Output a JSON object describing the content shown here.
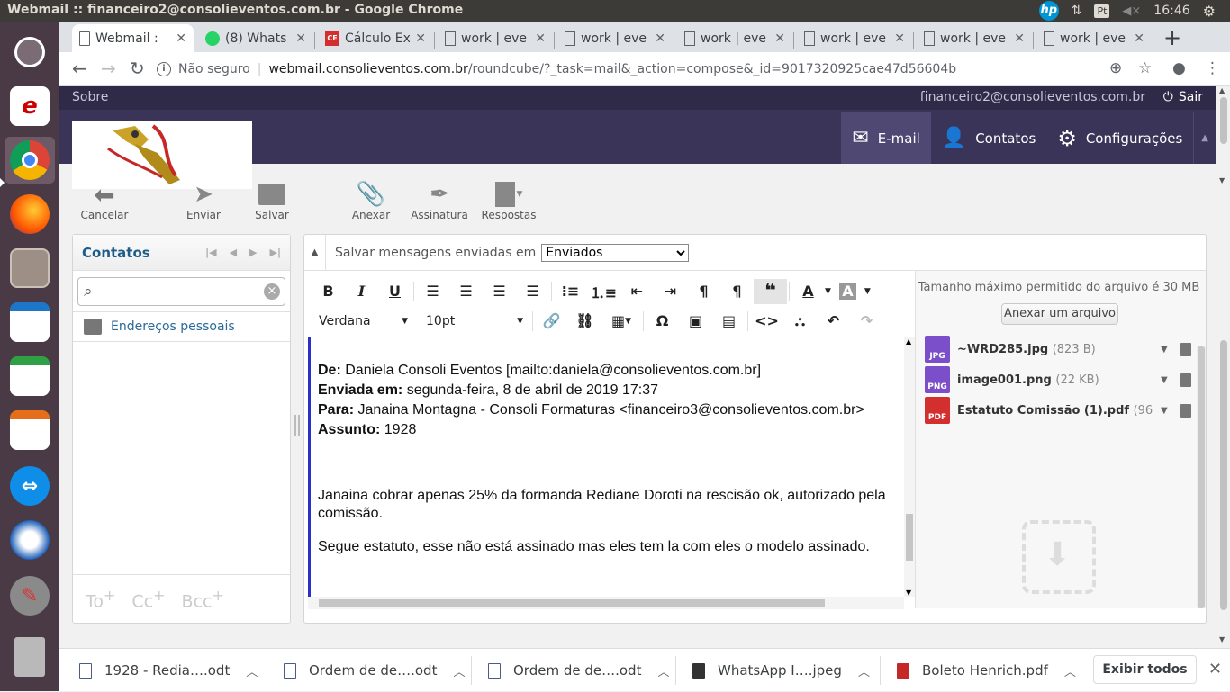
{
  "os_panel": {
    "window_title": "Webmail :: financeiro2@consolieventos.com.br - Google Chrome",
    "keyboard_layout": "Pt",
    "time": "16:46"
  },
  "launcher": {
    "items": [
      "ubuntu-dash-icon",
      "evince-icon",
      "chrome-icon",
      "firefox-icon",
      "files-icon",
      "impress-icon",
      "calc-icon",
      "writer-icon",
      "teamviewer-icon",
      "thunderbird-icon",
      "settings-icon",
      "trash-icon"
    ]
  },
  "browser": {
    "tabs": [
      {
        "label": "Webmail :",
        "icon": "page-icon",
        "active": true
      },
      {
        "label": "(8) Whats",
        "icon": "whatsapp-icon",
        "active": false
      },
      {
        "label": "Cálculo Ex",
        "icon": "ce-icon",
        "active": false
      },
      {
        "label": "work | eve",
        "icon": "page-icon",
        "active": false
      },
      {
        "label": "work | eve",
        "icon": "page-icon",
        "active": false
      },
      {
        "label": "work | eve",
        "icon": "page-icon",
        "active": false
      },
      {
        "label": "work | eve",
        "icon": "page-icon",
        "active": false
      },
      {
        "label": "work | eve",
        "icon": "page-icon",
        "active": false
      },
      {
        "label": "work | eve",
        "icon": "page-icon",
        "active": false
      }
    ],
    "security_label": "Não seguro",
    "url_host": "webmail.consolieventos.com.br",
    "url_path": "/roundcube/?_task=mail&_action=compose&_id=9017320925cae47d56604b"
  },
  "roundcube": {
    "top_links": {
      "about": "Sobre",
      "user": "financeiro2@consolieventos.com.br",
      "logout": "Sair"
    },
    "tasks": [
      {
        "label": "E-mail",
        "icon": "mail-icon",
        "selected": true
      },
      {
        "label": "Contatos",
        "icon": "contacts-icon",
        "selected": false
      },
      {
        "label": "Configurações",
        "icon": "gear-icon",
        "selected": false
      }
    ],
    "toolbar": {
      "cancel": "Cancelar",
      "send": "Enviar",
      "save": "Salvar",
      "attach": "Anexar",
      "signature": "Assinatura",
      "responses": "Respostas"
    },
    "contacts": {
      "title": "Contatos",
      "search_placeholder": "",
      "addressbook": "Endereços pessoais",
      "recipients": [
        "To",
        "Cc",
        "Bcc"
      ]
    },
    "compose": {
      "save_sent_label": "Salvar mensagens enviadas em",
      "save_sent_value": "Enviados",
      "font_family": "Verdana",
      "font_size": "10pt",
      "body": {
        "from_label": "De:",
        "from_value": "Daniela Consoli Eventos [mailto:daniela@consolieventos.com.br]",
        "sent_label": "Enviada em:",
        "sent_value": "segunda-feira, 8 de abril de 2019 17:37",
        "to_label": "Para:",
        "to_value": "Janaina Montagna - Consoli Formaturas <financeiro3@consolieventos.com.br>",
        "subject_label": "Assunto:",
        "subject_value": "1928",
        "para1": "Janaina cobrar apenas 25% da formanda Rediane Doroti na rescisão ok, autorizado pela comissão.",
        "para2": "Segue estatuto, esse não está assinado mas eles tem la com eles o modelo assinado."
      }
    },
    "attachments": {
      "max_size_note": "Tamanho máximo permitido do arquivo é 30 MB",
      "add_button": "Anexar um arquivo",
      "files": [
        {
          "name": "~WRD285.jpg",
          "size": "(823 B)",
          "type": "JPG",
          "color": "#7b4fc9"
        },
        {
          "name": "image001.png",
          "size": "(22 KB)",
          "type": "PNG",
          "color": "#7b4fc9"
        },
        {
          "name": "Estatuto Comissão (1).pdf",
          "size": "(96 …",
          "type": "PDF",
          "color": "#d32f2f"
        }
      ]
    }
  },
  "downloads": {
    "items": [
      {
        "name": "1928 - Redia….odt",
        "icon": "document-icon"
      },
      {
        "name": "Ordem de de….odt",
        "icon": "document-icon"
      },
      {
        "name": "Ordem de de….odt",
        "icon": "document-icon"
      },
      {
        "name": "WhatsApp I….jpeg",
        "icon": "image-icon"
      },
      {
        "name": "Boleto Henrich.pdf",
        "icon": "pdf-icon"
      }
    ],
    "show_all": "Exibir todos"
  }
}
